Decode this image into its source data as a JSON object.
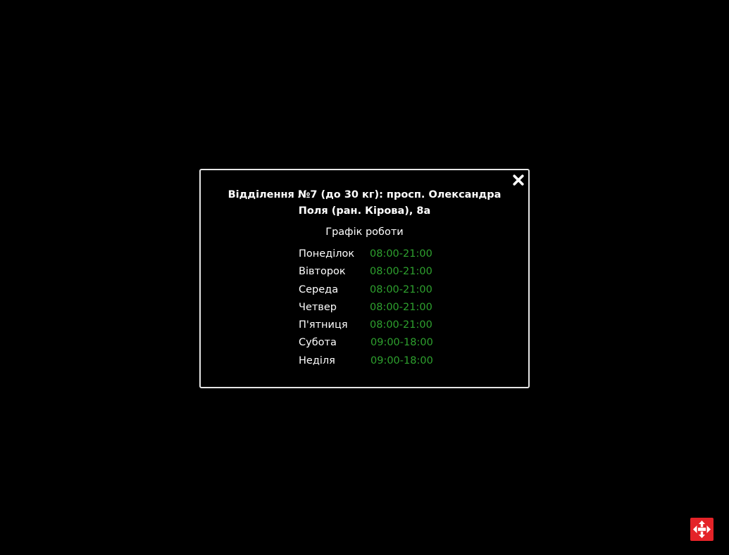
{
  "modal": {
    "title": "Відділення №7 (до 30 кг): просп. Олександра Поля (ран. Кірова), 8а",
    "subtitle": "Графік роботи",
    "close_icon": "close-icon",
    "schedule": [
      {
        "day": "Понеділок",
        "hours": "08:00-21:00"
      },
      {
        "day": "Вівторок",
        "hours": "08:00-21:00"
      },
      {
        "day": "Середа",
        "hours": "08:00-21:00"
      },
      {
        "day": "Четвер",
        "hours": "08:00-21:00"
      },
      {
        "day": "П'ятниця",
        "hours": "08:00-21:00"
      },
      {
        "day": "Субота",
        "hours": "09:00-18:00"
      },
      {
        "day": "Неділя",
        "hours": "09:00-18:00"
      }
    ]
  },
  "logo": {
    "icon": "nova-poshta-logo-icon",
    "color": "#e42328"
  },
  "colors": {
    "background": "#000000",
    "text": "#ffffff",
    "hours": "#2ea12e",
    "border": "#e6e6e6"
  }
}
